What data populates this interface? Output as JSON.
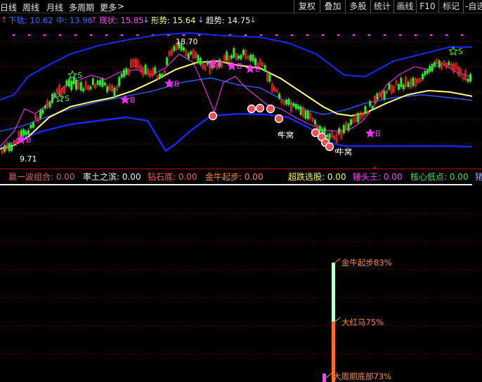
{
  "toolbar": {
    "periods": [
      "日线",
      "周线",
      "月线",
      "多周期",
      "更多"
    ],
    "more_arrow": ">",
    "buttons": [
      "复权",
      "叠加",
      "多股",
      "统计",
      "画线",
      "F10",
      "标记",
      "-自选"
    ]
  },
  "legend": {
    "lower_band": "下轨: 10.62",
    "mid_band": "中: 13.96",
    "status": "现状: 15.85",
    "pattern": "形势: 15.64",
    "trend": "趋势: 14.75",
    "arrow_up": "↑",
    "arrow_down": "↓"
  },
  "main_chart": {
    "price_high_label": "18.70",
    "price_low_label": "9.71",
    "buy_tag": "B",
    "sell_tag": "S",
    "niu_label": "牛窝",
    "dollar_mark": "$",
    "colors": {
      "outer_band": "#1428ff",
      "yellow_line": "#ffff7a",
      "magenta_line": "#e030e0",
      "candle_up": "#ff2a2a",
      "candle_down": "#2ee82e",
      "star": "#ff2eff"
    }
  },
  "sub_legend": [
    {
      "label": "赢一波组合: 0.00",
      "color": "#d06060"
    },
    {
      "label": "率土之滨: 0.00",
      "color": "#f2f2f2"
    },
    {
      "label": "钻石底: 0.00",
      "color": "#ff5a5a"
    },
    {
      "label": "金牛起步: 0.00",
      "color": "#ff8a30"
    },
    {
      "label": "超跌选股: 0.00",
      "color": "#ffff40"
    },
    {
      "label": "锤头王: 0.00",
      "color": "#ff40ff"
    },
    {
      "label": "核心低点: 0.00",
      "color": "#50e050"
    },
    {
      "label": "猪",
      "color": "#a0a0ff"
    }
  ],
  "lower_panel": {
    "labels": [
      {
        "text": "金牛起步83%",
        "color": "#ff8a30"
      },
      {
        "text": "大红马75%",
        "color": "#ff8a30"
      },
      {
        "text": "大周期底部73%",
        "color": "#ff8a30"
      }
    ]
  }
}
